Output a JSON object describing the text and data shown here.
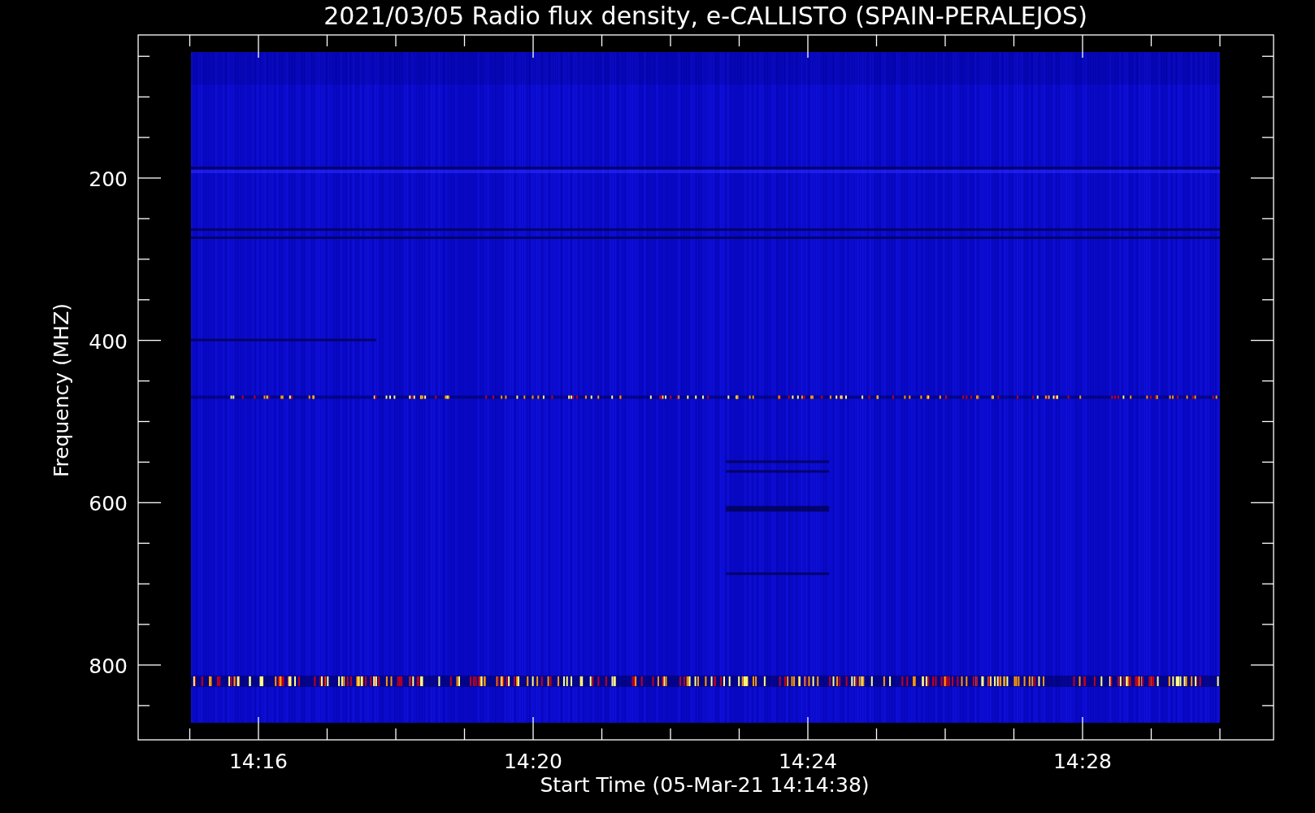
{
  "title": "2021/03/05  Radio flux density, e-CALLISTO (SPAIN-PERALEJOS)",
  "plot": {
    "ylabel": "Frequency (MHZ)",
    "xlabel": "Start Time (05-Mar-21 14:14:38)",
    "yticks": [
      "200",
      "400",
      "600",
      "800"
    ],
    "xticks": [
      "14:16",
      "14:20",
      "14:24",
      "14:28"
    ]
  }
}
